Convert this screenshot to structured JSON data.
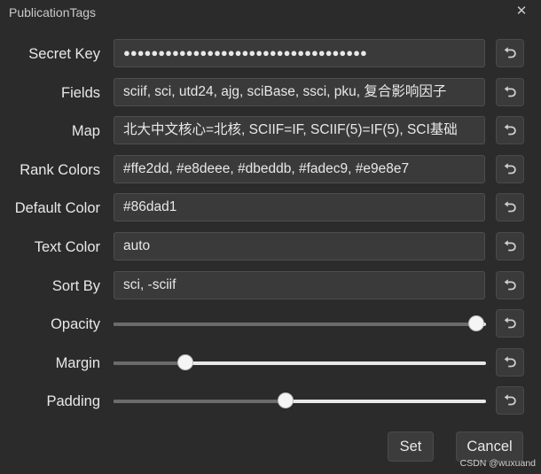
{
  "window": {
    "title": "PublicationTags",
    "close_glyph": "✕"
  },
  "fields": [
    {
      "key": "secret_key",
      "label": "Secret Key",
      "value": "●●●●●●●●●●●●●●●●●●●●●●●●●●●●●●●●●●●",
      "masked": true
    },
    {
      "key": "fields",
      "label": "Fields",
      "value": "sciif, sci, utd24, ajg, sciBase, ssci, pku, 复合影响因子"
    },
    {
      "key": "map",
      "label": "Map",
      "value": "北大中文核心=北核, SCIIF=IF, SCIIF(5)=IF(5), SCI基础"
    },
    {
      "key": "rank_colors",
      "label": "Rank Colors",
      "value": "#ffe2dd, #e8deee, #dbeddb, #fadec9, #e9e8e7"
    },
    {
      "key": "default_color",
      "label": "Default Color",
      "value": "#86dad1"
    },
    {
      "key": "text_color",
      "label": "Text Color",
      "value": "auto"
    },
    {
      "key": "sort_by",
      "label": "Sort By",
      "value": "sci, -sciif"
    }
  ],
  "sliders": [
    {
      "key": "opacity",
      "label": "Opacity",
      "value": 1.0
    },
    {
      "key": "margin",
      "label": "Margin",
      "value": 0.175
    },
    {
      "key": "padding",
      "label": "Padding",
      "value": 0.46
    }
  ],
  "buttons": {
    "set": "Set",
    "cancel": "Cancel"
  },
  "watermark": "CSDN @wuxuand",
  "icons": {
    "reset": "reset-arrow-icon",
    "close": "close-icon"
  }
}
